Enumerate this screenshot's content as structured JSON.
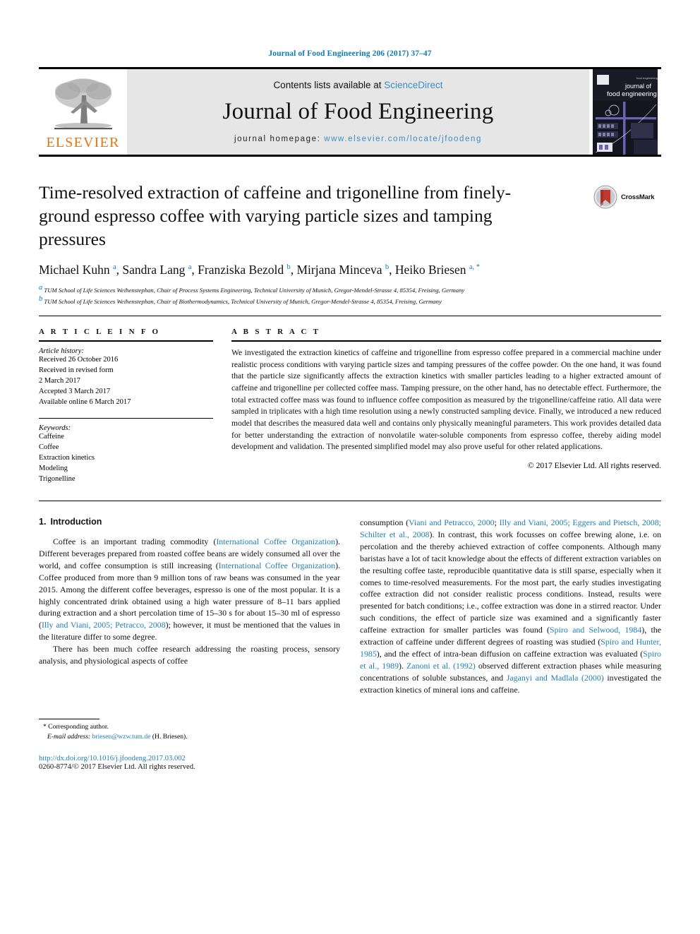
{
  "running_head": "Journal of Food Engineering 206 (2017) 37–47",
  "masthead": {
    "publisher_name": "ELSEVIER",
    "contents_prefix": "Contents lists available at ",
    "contents_link": "ScienceDirect",
    "journal_title": "Journal of Food Engineering",
    "homepage_prefix": "journal homepage: ",
    "homepage_url": "www.elsevier.com/locate/jfoodeng",
    "cover_title_line1": "journal of",
    "cover_title_line2": "food engineering"
  },
  "article": {
    "title": "Time-resolved extraction of caffeine and trigonelline from finely-ground espresso coffee with varying particle sizes and tamping pressures",
    "crossmark_label": "CrossMark",
    "authors_html": "Michael Kuhn <sup>a</sup>, Sandra Lang <sup>a</sup>, Franziska Bezold <sup>b</sup>, Mirjana Minceva <sup>b</sup>, Heiko Briesen <sup>a, *</sup>",
    "affiliations": [
      "TUM School of Life Sciences Weihenstephan, Chair of Process Systems Engineering, Technical University of Munich, Gregor-Mendel-Strasse 4, 85354, Freising, Germany",
      "TUM School of Life Sciences Weihenstephan, Chair of Biothermodynamics, Technical University of Munich, Gregor-Mendel-Strasse 4, 85354, Freising, Germany"
    ],
    "affiliation_marks": [
      "a",
      "b"
    ]
  },
  "article_info": {
    "heading": "A R T I C L E  I N F O",
    "history_title": "Article history:",
    "history": [
      "Received 26 October 2016",
      "Received in revised form",
      "2 March 2017",
      "Accepted 3 March 2017",
      "Available online 6 March 2017"
    ],
    "keywords_title": "Keywords:",
    "keywords": [
      "Caffeine",
      "Coffee",
      "Extraction kinetics",
      "Modeling",
      "Trigonelline"
    ]
  },
  "abstract": {
    "heading": "A B S T R A C T",
    "text": "We investigated the extraction kinetics of caffeine and trigonelline from espresso coffee prepared in a commercial machine under realistic process conditions with varying particle sizes and tamping pressures of the coffee powder. On the one hand, it was found that the particle size significantly affects the extraction kinetics with smaller particles leading to a higher extracted amount of caffeine and trigonelline per collected coffee mass. Tamping pressure, on the other hand, has no detectable effect. Furthermore, the total extracted coffee mass was found to influence coffee composition as measured by the trigonelline/caffeine ratio. All data were sampled in triplicates with a high time resolution using a newly constructed sampling device. Finally, we introduced a new reduced model that describes the measured data well and contains only physically meaningful parameters. This work provides detailed data for better understanding the extraction of nonvolatile water-soluble components from espresso coffee, thereby aiding model development and validation. The presented simplified model may also prove useful for other related applications.",
    "copyright": "© 2017 Elsevier Ltd. All rights reserved."
  },
  "introduction": {
    "number": "1.",
    "heading": "Introduction",
    "paragraph1_html": "Coffee is an important trading commodity (<a class=\"ref\" href=\"#\" data-name=\"citation-link\">International Coffee Organization</a>). Different beverages prepared from roasted coffee beans are widely consumed all over the world, and coffee consumption is still increasing (<a class=\"ref\" href=\"#\" data-name=\"citation-link\">International Coffee Organization</a>). Coffee produced from more than 9 million tons of raw beans was consumed in the year 2015. Among the different coffee beverages, espresso is one of the most popular. It is a highly concentrated drink obtained using a high water pressure of 8–11 bars applied during extraction and a short percolation time of 15–30 s for about 15–30 ml of espresso (<a class=\"ref\" href=\"#\" data-name=\"citation-link\">Illy and Viani, 2005; Petracco, 2008</a>); however, it must be mentioned that the values in the literature differ to some degree.",
    "paragraph2_html": "There has been much coffee research addressing the roasting process, sensory analysis, and physiological aspects of coffee consumption (<a class=\"ref\" href=\"#\" data-name=\"citation-link\">Viani and Petracco, 2000</a>; <a class=\"ref\" href=\"#\" data-name=\"citation-link\">Illy and Viani, 2005; Eggers and Pietsch, 2008; Schilter et al., 2008</a>). In contrast, this work focusses on coffee brewing alone, i.e. on percolation and the thereby achieved extraction of coffee components. Although many baristas have a lot of tacit knowledge about the effects of different extraction variables on the resulting coffee taste, reproducible quantitative data is still sparse, especially when it comes to time-resolved measurements. For the most part, the early studies investigating coffee extraction did not consider realistic process conditions. Instead, results were presented for batch conditions; i.e., coffee extraction was done in a stirred reactor. Under such conditions, the effect of particle size was examined and a significantly faster caffeine extraction for smaller particles was found (<a class=\"ref\" href=\"#\" data-name=\"citation-link\">Spiro and Selwood, 1984</a>), the extraction of caffeine under different degrees of roasting was studied (<a class=\"ref\" href=\"#\" data-name=\"citation-link\">Spiro and Hunter, 1985</a>), and the effect of intra-bean diffusion on caffeine extraction was evaluated (<a class=\"ref\" href=\"#\" data-name=\"citation-link\">Spiro et al., 1989</a>). <a class=\"ref\" href=\"#\" data-name=\"citation-link\">Zanoni et al. (1992)</a> observed different extraction phases while measuring concentrations of soluble substances, and <a class=\"ref\" href=\"#\" data-name=\"citation-link\">Jaganyi and Madlala (2000)</a> investigated the extraction kinetics of mineral ions and caffeine."
  },
  "footnote": {
    "star": "*",
    "corresponding_author": "Corresponding author.",
    "email_label": "E-mail address:",
    "email": "briesen@wzw.tum.de",
    "email_suffix": "(H. Briesen).",
    "doi": "http://dx.doi.org/10.1016/j.jfoodeng.2017.03.002",
    "issn_line": "0260-8774/© 2017 Elsevier Ltd. All rights reserved."
  },
  "colors": {
    "link": "#1f7eb5",
    "running_head": "#0b7bb5",
    "elsevier_orange": "#e87511",
    "masthead_bg": "#e6e6e6",
    "crossmark_red": "#c0392b"
  }
}
